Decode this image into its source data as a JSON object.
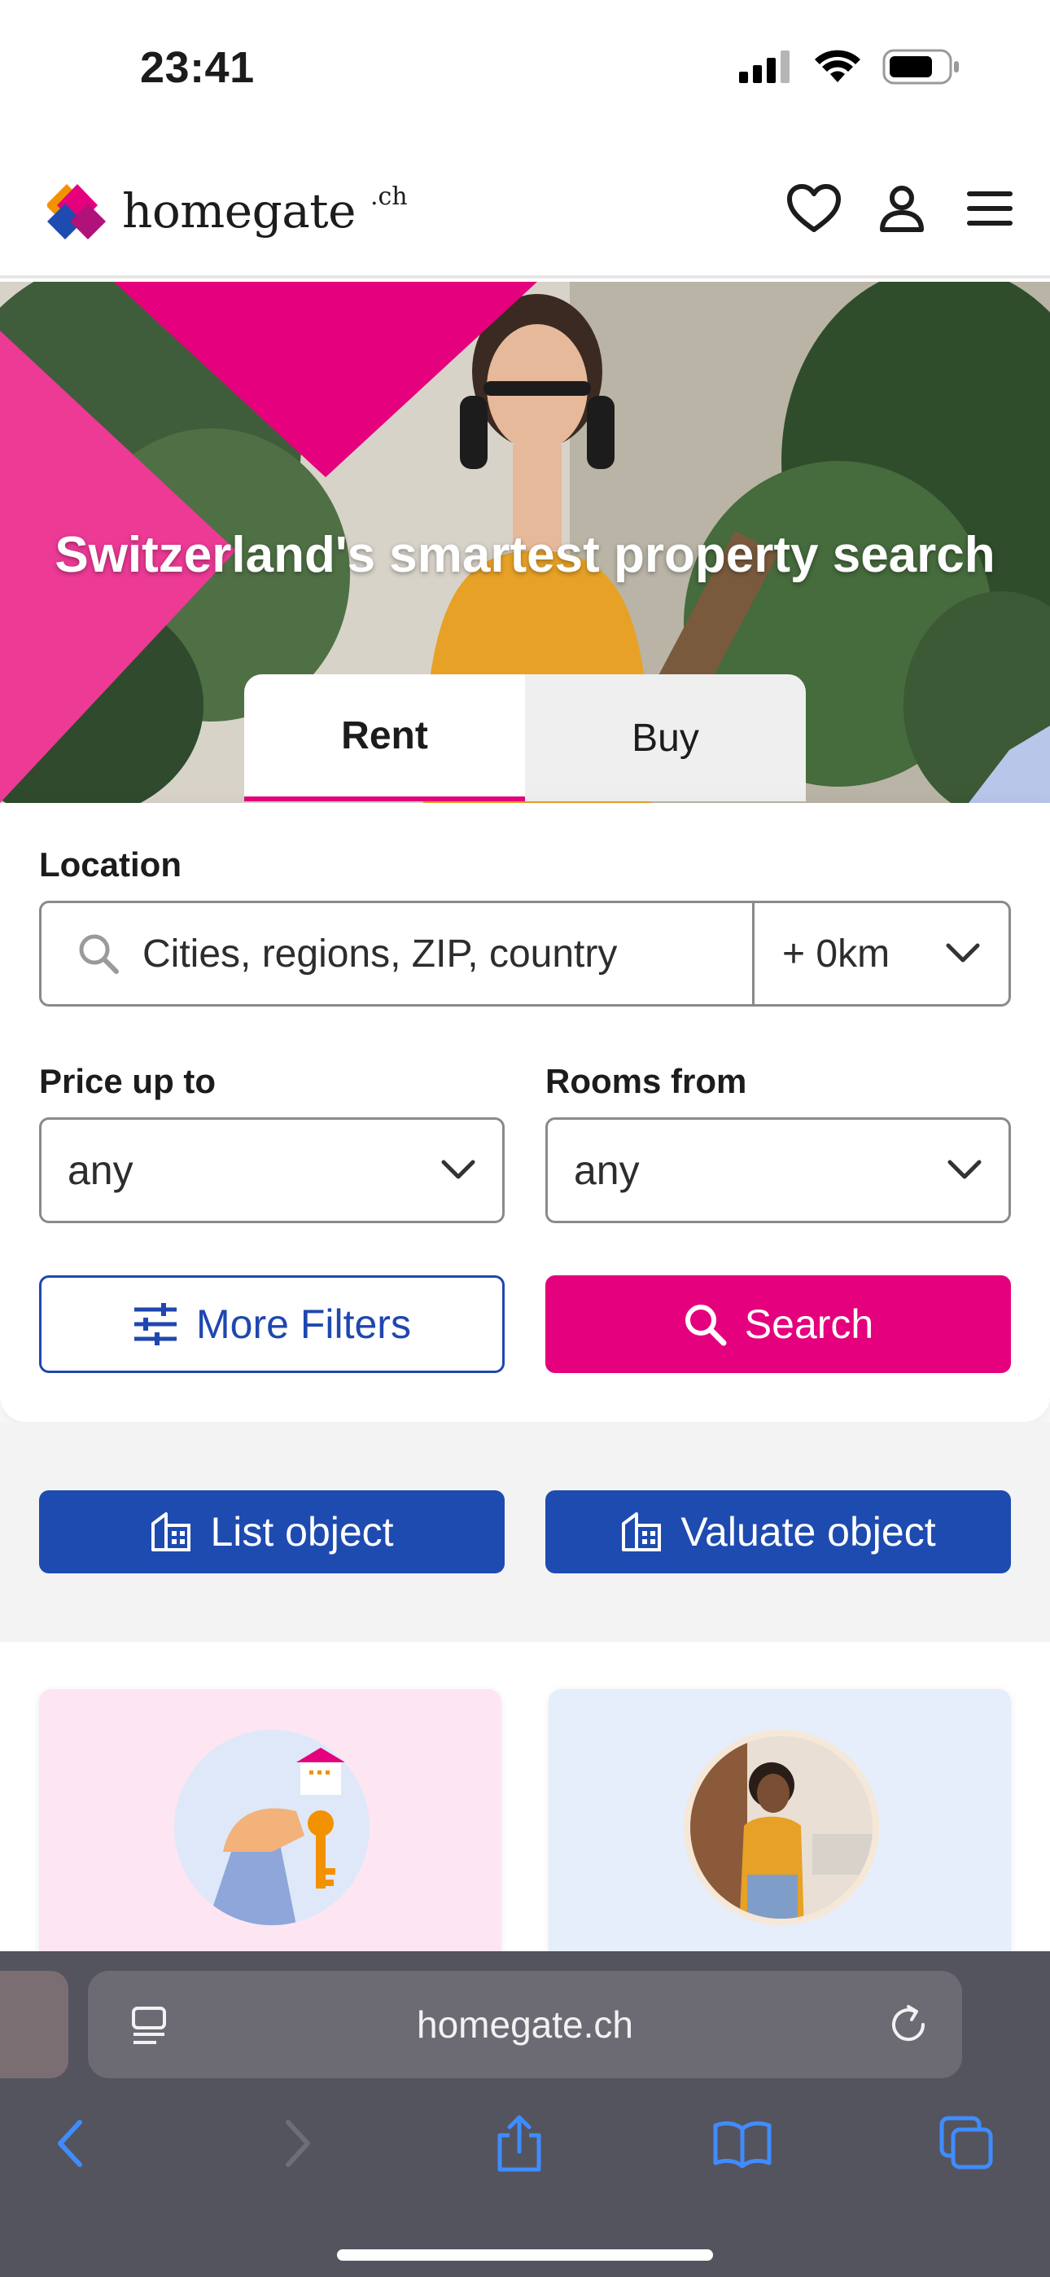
{
  "status_bar": {
    "time": "23:41"
  },
  "header": {
    "logo_text": "homegate",
    "logo_suffix": ".ch",
    "icons": [
      "heart-icon",
      "user-icon",
      "menu-icon"
    ]
  },
  "hero": {
    "title": "Switzerland's smartest property search",
    "tabs": [
      {
        "label": "Rent",
        "active": true
      },
      {
        "label": "Buy",
        "active": false
      }
    ]
  },
  "search": {
    "location_label": "Location",
    "location_placeholder": "Cities, regions, ZIP, country",
    "radius_value": "+ 0km",
    "price_label": "Price up to",
    "price_value": "any",
    "rooms_label": "Rooms from",
    "rooms_value": "any",
    "more_filters_label": "More Filters",
    "search_label": "Search"
  },
  "actions": {
    "list_object_label": "List object",
    "valuate_object_label": "Valuate object"
  },
  "safari": {
    "url": "homegate.ch"
  },
  "colors": {
    "brand_pink": "#e5007d",
    "brand_blue": "#1e4bb0",
    "card_pink_bg": "#fde6f1",
    "card_blue_bg": "#e6edfb"
  }
}
